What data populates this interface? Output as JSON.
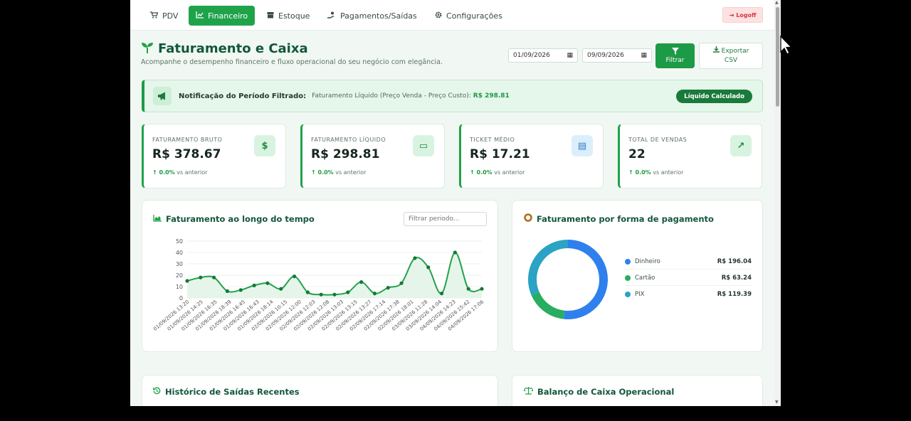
{
  "nav": {
    "items": [
      {
        "label": "PDV",
        "icon": "cart-icon"
      },
      {
        "label": "Financeiro",
        "icon": "chart-icon"
      },
      {
        "label": "Estoque",
        "icon": "box-icon"
      },
      {
        "label": "Pagamentos/Saídas",
        "icon": "hand-money-icon"
      },
      {
        "label": "Configurações",
        "icon": "gear-icon"
      }
    ],
    "logoff": "Logoff"
  },
  "header": {
    "title": "Faturamento e Caixa",
    "subtitle": "Acompanhe o desempenho financeiro e fluxo operacional do seu negócio com elegância.",
    "date_from": "01/09/2026",
    "date_to": "09/09/2026",
    "filter_label": "Filtrar",
    "export_label_1": "Exportar",
    "export_label_2": "CSV"
  },
  "notification": {
    "title": "Notificação do Período Filtrado:",
    "desc": "Faturamento Líquido (Preço Venda - Preço Custo):",
    "value": "R$ 298.81",
    "badge": "Líquido Calculado"
  },
  "kpis": [
    {
      "label": "FATURAMENTO BRUTO",
      "value": "R$ 378.67",
      "delta": "0.0%",
      "delta_suffix": "vs anterior",
      "icon": "$"
    },
    {
      "label": "FATURAMENTO LÍQUIDO",
      "value": "R$ 298.81",
      "delta": "0.0%",
      "delta_suffix": "vs anterior",
      "icon": "▭"
    },
    {
      "label": "TICKET MÉDIO",
      "value": "R$ 17.21",
      "delta": "0.0%",
      "delta_suffix": "vs anterior",
      "icon": "▤"
    },
    {
      "label": "TOTAL DE VENDAS",
      "value": "22",
      "delta": "0.0%",
      "delta_suffix": "vs anterior",
      "icon": "↗"
    }
  ],
  "line_card": {
    "title": "Faturamento ao longo do tempo",
    "filter_placeholder": "Filtrar periodo..."
  },
  "pie_card": {
    "title": "Faturamento por forma de pagamento",
    "legend": [
      {
        "name": "Dinheiro",
        "value": "R$ 196.04",
        "color": "#2f80ed"
      },
      {
        "name": "Cartão",
        "value": "R$ 63.24",
        "color": "#27ae60"
      },
      {
        "name": "PIX",
        "value": "R$ 119.39",
        "color": "#2aa3c4"
      }
    ]
  },
  "bottom_cards": {
    "history_title": "Histórico de Saídas Recentes",
    "balance_title": "Balanço de Caixa Operacional"
  },
  "chart_data": [
    {
      "type": "area",
      "ylim": [
        0,
        50
      ],
      "yticks": [
        0,
        10,
        20,
        30,
        40,
        50
      ],
      "xtick_labels": [
        "01/09/2026 13:20",
        "01/09/2026 14:25",
        "01/09/2026 16:35",
        "01/09/2026 18:39",
        "01/09/2026 16:45",
        "01/09/2026 16:43",
        "01/09/2026 18:14",
        "02/09/2026 10:15",
        "02/09/2026 12:00",
        "02/09/2026 12:03",
        "02/09/2026 12:08",
        "02/09/2026 13:03",
        "02/09/2026 13:15",
        "02/09/2026 13:27",
        "02/09/2026 17:14",
        "02/09/2026 17:38",
        "02/09/2026 18:01",
        "03/09/2026 11:28",
        "03/09/2026 14:04",
        "04/09/2026 14:23",
        "04/09/2026 15:42",
        "04/09/2026 17:06"
      ],
      "values": [
        15,
        18,
        18,
        6,
        7,
        11,
        13,
        8,
        19,
        5,
        3,
        3,
        5,
        14,
        4,
        9,
        13,
        35,
        27,
        4,
        40,
        8,
        8
      ],
      "color": "#23a24d",
      "grid": true
    },
    {
      "type": "pie",
      "donut": true,
      "labels": [
        "Dinheiro",
        "Cartão",
        "PIX"
      ],
      "values": [
        196.04,
        63.24,
        119.39
      ],
      "colors": [
        "#2f80ed",
        "#27ae60",
        "#2aa3c4"
      ],
      "legend": "right"
    }
  ]
}
